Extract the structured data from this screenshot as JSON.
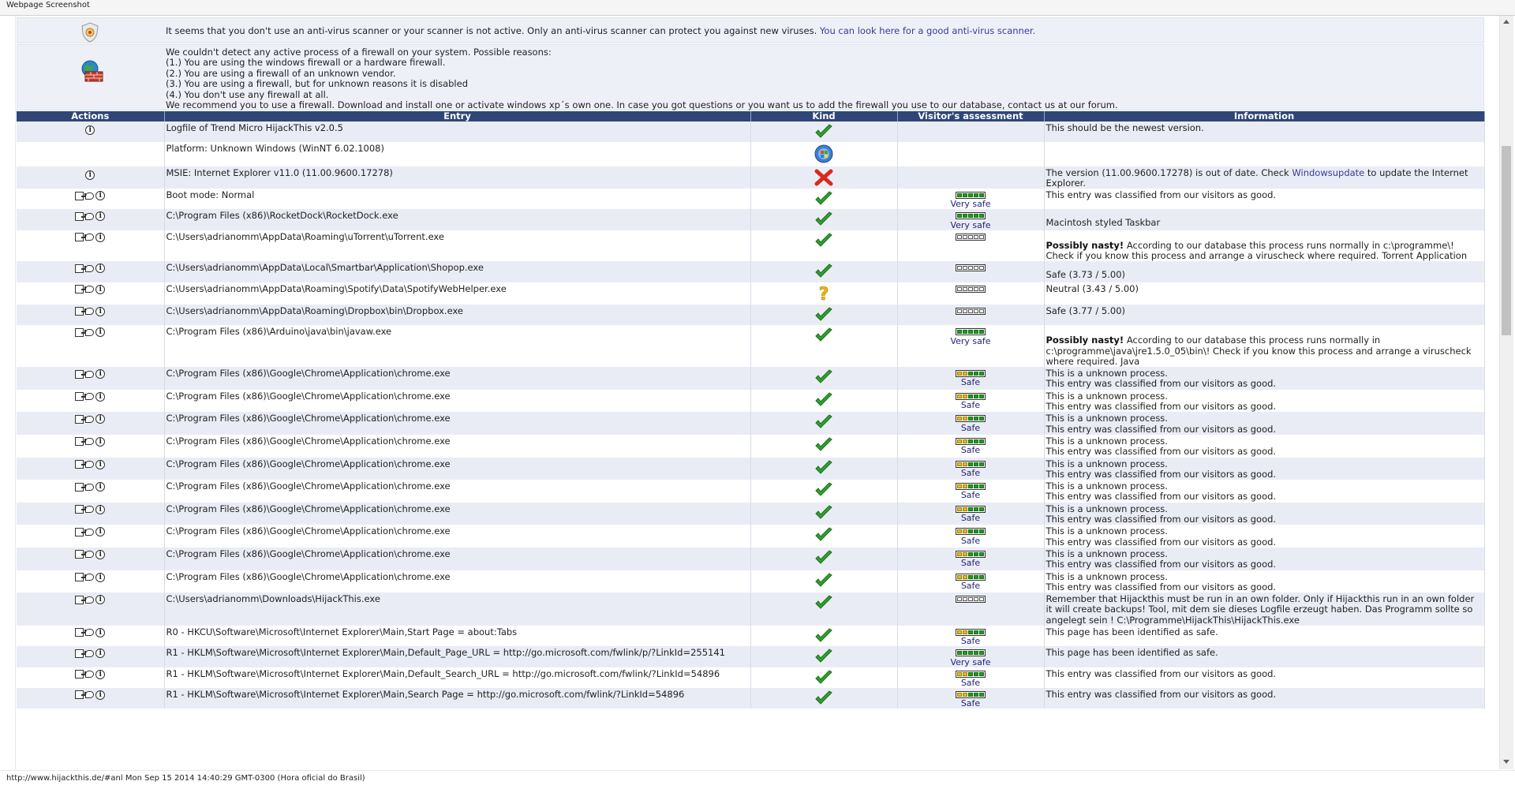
{
  "window": {
    "title": "Webpage Screenshot"
  },
  "notices": {
    "antivirus": {
      "text": "It seems that you don't use an anti-virus scanner or your scanner is not active. Only an anti-virus scanner can protect you against new viruses.",
      "link": "You can look here for a good anti-virus scanner."
    },
    "firewall": {
      "lines": [
        "We couldn't detect any active process of a firewall on your system. Possible reasons:",
        "(1.) You are using the windows firewall or a hardware firewall.",
        "(2.) You are using a firewall of an unknown vendor.",
        "(3.) You are using a firewall, but for unknown reasons it is disabled",
        "(4.) You don't use any firewall at all.",
        "We recommend you to use a firewall. Download and install one or activate windows xp´s own one. In case you got questions or you want us to add the firewall you use to our database, contact us at our forum."
      ]
    }
  },
  "table": {
    "headers": {
      "actions": "Actions",
      "entry": "Entry",
      "kind": "Kind",
      "assessment": "Visitor's assessment",
      "information": "Information"
    },
    "rows": [
      {
        "actions": "info",
        "entry": "Logfile of Trend Micro HijackThis v2.0.5",
        "kind": "check",
        "assess": "none",
        "label": "",
        "info": "This should be the newest version."
      },
      {
        "actions": "none",
        "entry": "Platform: Unknown Windows (WinNT 6.02.1008)",
        "kind": "windows",
        "assess": "none",
        "label": "",
        "info": ""
      },
      {
        "actions": "info",
        "entry": "MSIE: Internet Explorer v11.0 (11.00.9600.17278)",
        "kind": "cross",
        "assess": "none",
        "label": "",
        "info": "The version (11.00.9600.17278) is out of date. Check ",
        "info_link": "Windowsupdate",
        "info_after": " to update the Internet Explorer."
      },
      {
        "actions": "full",
        "entry": "Boot mode: Normal",
        "kind": "check",
        "assess": "very-safe",
        "label": "Very safe",
        "info": "This entry was classified from our visitors as good."
      },
      {
        "actions": "full",
        "entry": "C:\\Program Files (x86)\\RocketDock\\RocketDock.exe",
        "kind": "check",
        "assess": "very-safe",
        "label": "Very safe",
        "info": "",
        "info2": "Macintosh styled Taskbar"
      },
      {
        "actions": "full",
        "entry": "C:\\Users\\adrianomm\\AppData\\Roaming\\uTorrent\\uTorrent.exe",
        "kind": "check",
        "assess": "empty",
        "label": "",
        "info": "",
        "info_bold": "Possibly nasty!",
        "info2": " According to our database this process runs normally in c:\\programme\\! Check if you know this process and arrange a viruscheck where required. Torrent Application"
      },
      {
        "actions": "full",
        "entry": "C:\\Users\\adrianomm\\AppData\\Local\\Smartbar\\Application\\Shopop.exe",
        "kind": "check",
        "assess": "empty",
        "label": "",
        "info": "",
        "info2": "Safe (3.73 / 5.00)"
      },
      {
        "actions": "full",
        "entry": "C:\\Users\\adrianomm\\AppData\\Roaming\\Spotify\\Data\\SpotifyWebHelper.exe",
        "kind": "question",
        "assess": "empty",
        "label": "",
        "info": "Neutral (3.43 / 5.00)"
      },
      {
        "actions": "full",
        "entry": "C:\\Users\\adrianomm\\AppData\\Roaming\\Dropbox\\bin\\Dropbox.exe",
        "kind": "check",
        "assess": "empty",
        "label": "",
        "info": "Safe (3.77 / 5.00)"
      },
      {
        "actions": "full",
        "entry": "C:\\Program Files (x86)\\Arduino\\java\\bin\\javaw.exe",
        "kind": "check",
        "assess": "very-safe",
        "label": "Very safe",
        "info": "",
        "info_bold": "Possibly nasty!",
        "info2": " According to our database this process runs normally in c:\\programme\\java\\jre1.5.0_05\\bin\\! Check if you know this process and arrange a viruscheck where required. Java"
      },
      {
        "actions": "full",
        "entry": "C:\\Program Files (x86)\\Google\\Chrome\\Application\\chrome.exe",
        "kind": "check",
        "assess": "safe",
        "label": "Safe",
        "info": "This is a unknown process.",
        "info2": "This entry was classified from our visitors as good."
      },
      {
        "actions": "full",
        "entry": "C:\\Program Files (x86)\\Google\\Chrome\\Application\\chrome.exe",
        "kind": "check",
        "assess": "safe",
        "label": "Safe",
        "info": "This is a unknown process.",
        "info2": "This entry was classified from our visitors as good."
      },
      {
        "actions": "full",
        "entry": "C:\\Program Files (x86)\\Google\\Chrome\\Application\\chrome.exe",
        "kind": "check",
        "assess": "safe",
        "label": "Safe",
        "info": "This is a unknown process.",
        "info2": "This entry was classified from our visitors as good."
      },
      {
        "actions": "full",
        "entry": "C:\\Program Files (x86)\\Google\\Chrome\\Application\\chrome.exe",
        "kind": "check",
        "assess": "safe",
        "label": "Safe",
        "info": "This is a unknown process.",
        "info2": "This entry was classified from our visitors as good."
      },
      {
        "actions": "full",
        "entry": "C:\\Program Files (x86)\\Google\\Chrome\\Application\\chrome.exe",
        "kind": "check",
        "assess": "safe",
        "label": "Safe",
        "info": "This is a unknown process.",
        "info2": "This entry was classified from our visitors as good."
      },
      {
        "actions": "full",
        "entry": "C:\\Program Files (x86)\\Google\\Chrome\\Application\\chrome.exe",
        "kind": "check",
        "assess": "safe",
        "label": "Safe",
        "info": "This is a unknown process.",
        "info2": "This entry was classified from our visitors as good."
      },
      {
        "actions": "full",
        "entry": "C:\\Program Files (x86)\\Google\\Chrome\\Application\\chrome.exe",
        "kind": "check",
        "assess": "safe",
        "label": "Safe",
        "info": "This is a unknown process.",
        "info2": "This entry was classified from our visitors as good."
      },
      {
        "actions": "full",
        "entry": "C:\\Program Files (x86)\\Google\\Chrome\\Application\\chrome.exe",
        "kind": "check",
        "assess": "safe",
        "label": "Safe",
        "info": "This is a unknown process.",
        "info2": "This entry was classified from our visitors as good."
      },
      {
        "actions": "full",
        "entry": "C:\\Program Files (x86)\\Google\\Chrome\\Application\\chrome.exe",
        "kind": "check",
        "assess": "safe",
        "label": "Safe",
        "info": "This is a unknown process.",
        "info2": "This entry was classified from our visitors as good."
      },
      {
        "actions": "full",
        "entry": "C:\\Program Files (x86)\\Google\\Chrome\\Application\\chrome.exe",
        "kind": "check",
        "assess": "safe",
        "label": "Safe",
        "info": "This is a unknown process.",
        "info2": "This entry was classified from our visitors as good."
      },
      {
        "actions": "full",
        "entry": "C:\\Users\\adrianomm\\Downloads\\HijackThis.exe",
        "kind": "check",
        "assess": "empty",
        "label": "",
        "info": "Remember that Hijackthis must be run in an own folder. Only if Hijackthis run in an own folder it will create backups! Tool, mit dem sie dieses Logfile erzeugt haben. Das Programm sollte so angelegt sein ! C:\\Programme\\HijackThis\\HijackThis.exe"
      },
      {
        "actions": "full",
        "entry": "R0 - HKCU\\Software\\Microsoft\\Internet Explorer\\Main,Start Page = about:Tabs",
        "kind": "check",
        "assess": "safe",
        "label": "Safe",
        "info": "This page has been identified as safe."
      },
      {
        "actions": "full",
        "entry": "R1 - HKLM\\Software\\Microsoft\\Internet Explorer\\Main,Default_Page_URL = http://go.microsoft.com/fwlink/p/?LinkId=255141",
        "kind": "check",
        "assess": "very-safe",
        "label": "Very safe",
        "info": "This page has been identified as safe."
      },
      {
        "actions": "full",
        "entry": "R1 - HKLM\\Software\\Microsoft\\Internet Explorer\\Main,Default_Search_URL = http://go.microsoft.com/fwlink/?LinkId=54896",
        "kind": "check",
        "assess": "safe",
        "label": "Safe",
        "info": "This entry was classified from our visitors as good."
      },
      {
        "actions": "full",
        "entry": "R1 - HKLM\\Software\\Microsoft\\Internet Explorer\\Main,Search Page = http://go.microsoft.com/fwlink/?LinkId=54896",
        "kind": "check",
        "assess": "safe",
        "label": "Safe",
        "info": "This entry was classified from our visitors as good."
      }
    ]
  },
  "status": {
    "text": "http://www.hijackthis.de/#anl Mon Sep 15 2014 14:40:29 GMT-0300 (Hora oficial do Brasil)"
  }
}
